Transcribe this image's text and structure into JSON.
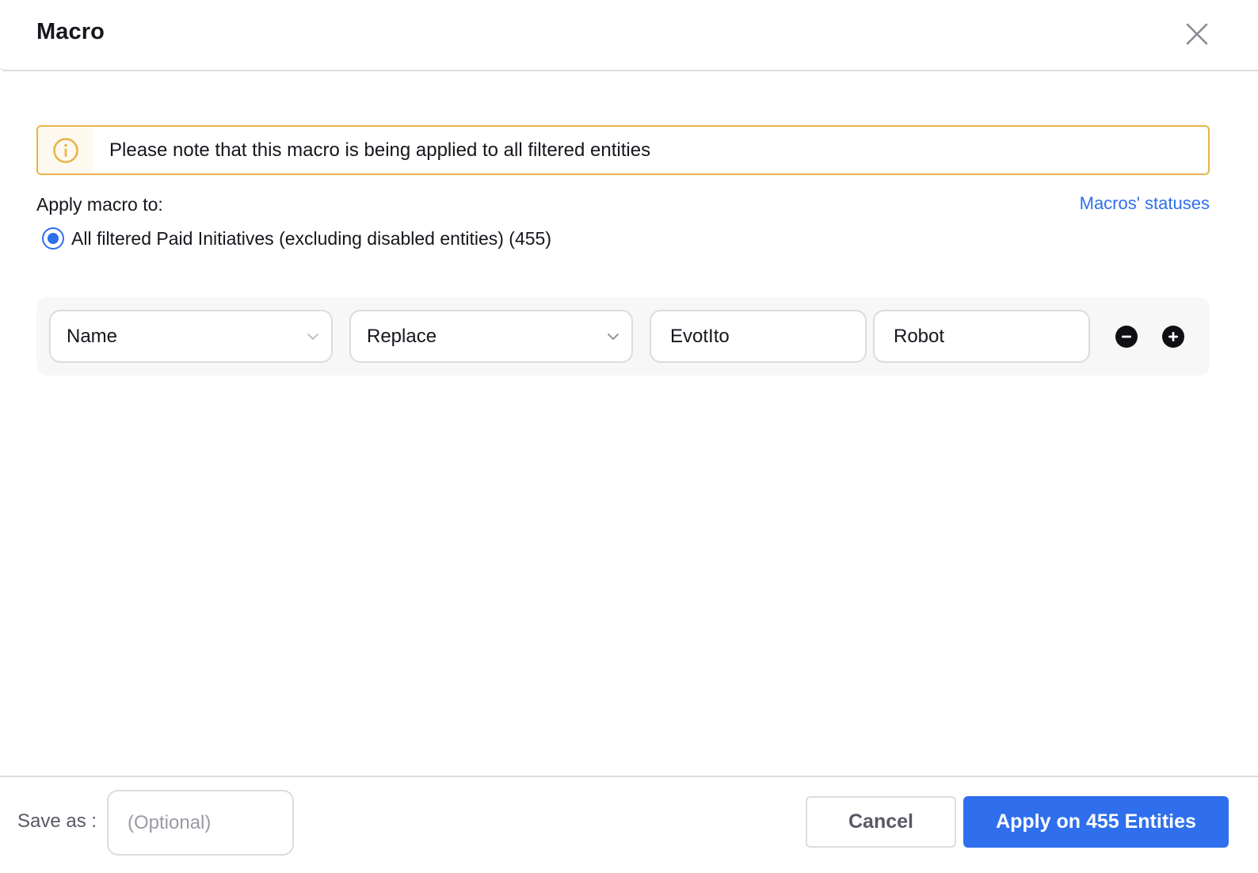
{
  "modal": {
    "title": "Macro",
    "close_icon": "close-icon"
  },
  "banner": {
    "icon": "info-circle-icon",
    "text": "Please note that this macro is being applied to all filtered entities",
    "colors": {
      "border": "#e8b34a",
      "icon": "#e8b34a",
      "icon_background": "#fef9ee"
    }
  },
  "apply_section": {
    "label": "Apply macro to:",
    "statuses_link": "Macros' statuses",
    "options": [
      {
        "label": "All filtered Paid Initiatives (excluding disabled entities) (455)",
        "selected": true
      }
    ]
  },
  "rule": {
    "field_select": {
      "value": "Name",
      "icon": "chevron-down-icon"
    },
    "operation_select": {
      "value": "Replace",
      "icon": "chevron-down-icon"
    },
    "find_input": {
      "value": "EvotIto"
    },
    "replace_input": {
      "value": "Robot"
    },
    "remove_button_icon": "minus-circle-icon",
    "add_button_icon": "plus-circle-icon"
  },
  "footer": {
    "save_label": "Save as :",
    "save_placeholder": "(Optional)",
    "save_value": "",
    "cancel_label": "Cancel",
    "apply_label": "Apply on 455 Entities"
  },
  "colors": {
    "accent": "#2f6fed",
    "text": "#16161d",
    "muted_text": "#585865",
    "border": "#dcdcdf",
    "rule_background": "#f7f7f8"
  }
}
